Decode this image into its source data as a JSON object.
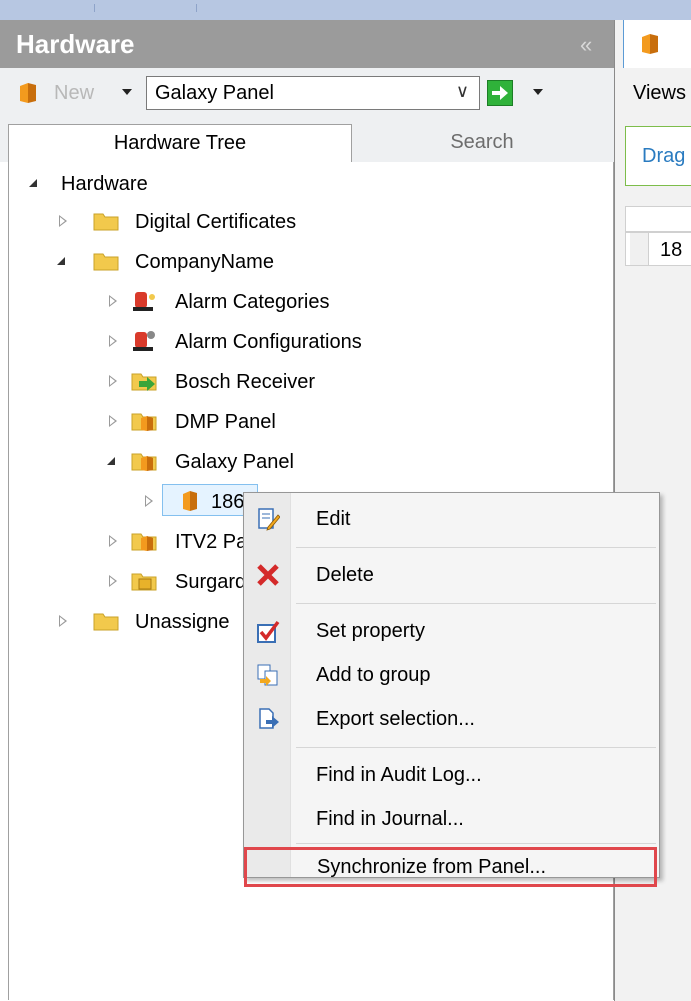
{
  "pane": {
    "title": "Hardware",
    "collapse_glyph": "«",
    "toolbar": {
      "new_label": "New",
      "combo_value": "Galaxy Panel",
      "combo_arrow": "∨"
    },
    "tabs": {
      "active": "Hardware Tree",
      "inactive": "Search"
    }
  },
  "tree": {
    "root": "Hardware",
    "digital_certificates": "Digital Certificates",
    "company": "CompanyName",
    "alarm_categories": "Alarm Categories",
    "alarm_configurations": "Alarm Configurations",
    "bosch_receiver": "Bosch Receiver",
    "dmp_panel": "DMP Panel",
    "galaxy_panel": "Galaxy Panel",
    "panel_186": "186",
    "itv2": "ITV2 Pa",
    "surgard": "Surgard",
    "unassigned": "Unassigne"
  },
  "right_pane": {
    "views": "Views",
    "drag": "Drag",
    "row_value": "18"
  },
  "context_menu": {
    "edit": "Edit",
    "delete": "Delete",
    "set_property": "Set property",
    "add_to_group": "Add to group",
    "export_selection": "Export selection...",
    "find_audit": "Find in Audit Log...",
    "find_journal": "Find in Journal...",
    "synchronize": "Synchronize from Panel..."
  },
  "colors": {
    "header": "#9b9b9b",
    "highlight_border": "#e0474c",
    "folder": "#f2c94c",
    "panel_orange": "#f39a1e"
  }
}
